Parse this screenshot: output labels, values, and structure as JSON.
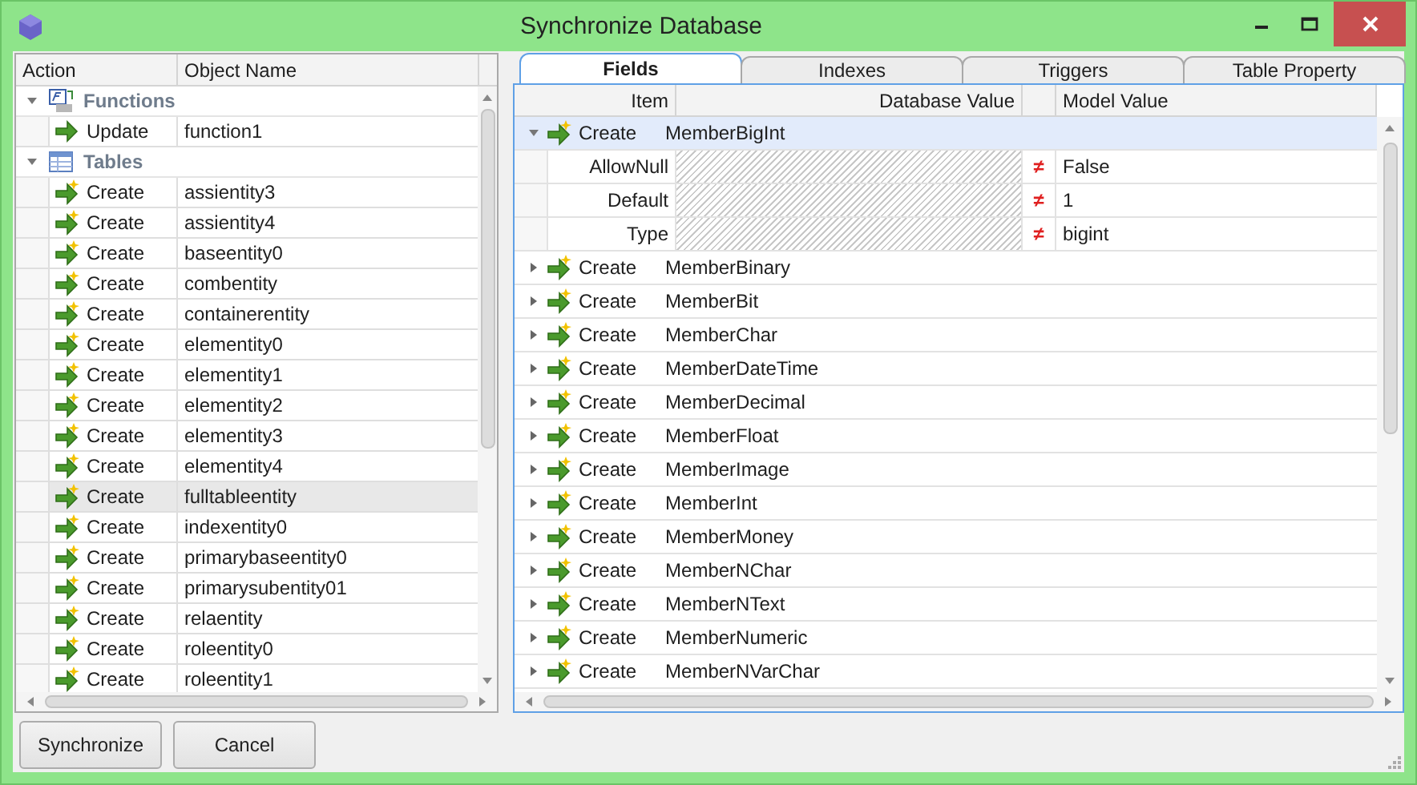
{
  "window": {
    "title": "Synchronize Database"
  },
  "objects": {
    "columns": [
      "Action",
      "Object Name"
    ],
    "groups": [
      {
        "name": "Functions",
        "kind": "functions",
        "expanded": true,
        "items": [
          {
            "action": "Update",
            "kind": "update",
            "name": "function1",
            "selected": false
          }
        ]
      },
      {
        "name": "Tables",
        "kind": "tables",
        "expanded": true,
        "items": [
          {
            "action": "Create",
            "kind": "create",
            "name": "assientity3",
            "selected": false
          },
          {
            "action": "Create",
            "kind": "create",
            "name": "assientity4",
            "selected": false
          },
          {
            "action": "Create",
            "kind": "create",
            "name": "baseentity0",
            "selected": false
          },
          {
            "action": "Create",
            "kind": "create",
            "name": "combentity",
            "selected": false
          },
          {
            "action": "Create",
            "kind": "create",
            "name": "containerentity",
            "selected": false
          },
          {
            "action": "Create",
            "kind": "create",
            "name": "elementity0",
            "selected": false
          },
          {
            "action": "Create",
            "kind": "create",
            "name": "elementity1",
            "selected": false
          },
          {
            "action": "Create",
            "kind": "create",
            "name": "elementity2",
            "selected": false
          },
          {
            "action": "Create",
            "kind": "create",
            "name": "elementity3",
            "selected": false
          },
          {
            "action": "Create",
            "kind": "create",
            "name": "elementity4",
            "selected": false
          },
          {
            "action": "Create",
            "kind": "create",
            "name": "fulltableentity",
            "selected": true
          },
          {
            "action": "Create",
            "kind": "create",
            "name": "indexentity0",
            "selected": false
          },
          {
            "action": "Create",
            "kind": "create",
            "name": "primarybaseentity0",
            "selected": false
          },
          {
            "action": "Create",
            "kind": "create",
            "name": "primarysubentity01",
            "selected": false
          },
          {
            "action": "Create",
            "kind": "create",
            "name": "relaentity",
            "selected": false
          },
          {
            "action": "Create",
            "kind": "create",
            "name": "roleentity0",
            "selected": false
          },
          {
            "action": "Create",
            "kind": "create",
            "name": "roleentity1",
            "selected": false
          }
        ]
      }
    ]
  },
  "details": {
    "tabs": [
      {
        "label": "Fields",
        "selected": true
      },
      {
        "label": "Indexes",
        "selected": false
      },
      {
        "label": "Triggers",
        "selected": false
      },
      {
        "label": "Table Property",
        "selected": false
      }
    ],
    "columns": {
      "item": "Item",
      "database_value": "Database Value",
      "model_value": "Model Value"
    },
    "rows": [
      {
        "action": "Create",
        "name": "MemberBigInt",
        "expanded": true,
        "selected": true,
        "properties": [
          {
            "item": "AllowNull",
            "database_missing": true,
            "compare": "≠",
            "model_value": "False"
          },
          {
            "item": "Default",
            "database_missing": true,
            "compare": "≠",
            "model_value": "1"
          },
          {
            "item": "Type",
            "database_missing": true,
            "compare": "≠",
            "model_value": "bigint"
          }
        ]
      },
      {
        "action": "Create",
        "name": "MemberBinary",
        "expanded": false,
        "selected": false
      },
      {
        "action": "Create",
        "name": "MemberBit",
        "expanded": false,
        "selected": false
      },
      {
        "action": "Create",
        "name": "MemberChar",
        "expanded": false,
        "selected": false
      },
      {
        "action": "Create",
        "name": "MemberDateTime",
        "expanded": false,
        "selected": false
      },
      {
        "action": "Create",
        "name": "MemberDecimal",
        "expanded": false,
        "selected": false
      },
      {
        "action": "Create",
        "name": "MemberFloat",
        "expanded": false,
        "selected": false
      },
      {
        "action": "Create",
        "name": "MemberImage",
        "expanded": false,
        "selected": false
      },
      {
        "action": "Create",
        "name": "MemberInt",
        "expanded": false,
        "selected": false
      },
      {
        "action": "Create",
        "name": "MemberMoney",
        "expanded": false,
        "selected": false
      },
      {
        "action": "Create",
        "name": "MemberNChar",
        "expanded": false,
        "selected": false
      },
      {
        "action": "Create",
        "name": "MemberNText",
        "expanded": false,
        "selected": false
      },
      {
        "action": "Create",
        "name": "MemberNumeric",
        "expanded": false,
        "selected": false
      },
      {
        "action": "Create",
        "name": "MemberNVarChar",
        "expanded": false,
        "selected": false
      }
    ]
  },
  "buttons": [
    "Synchronize",
    "Cancel"
  ]
}
